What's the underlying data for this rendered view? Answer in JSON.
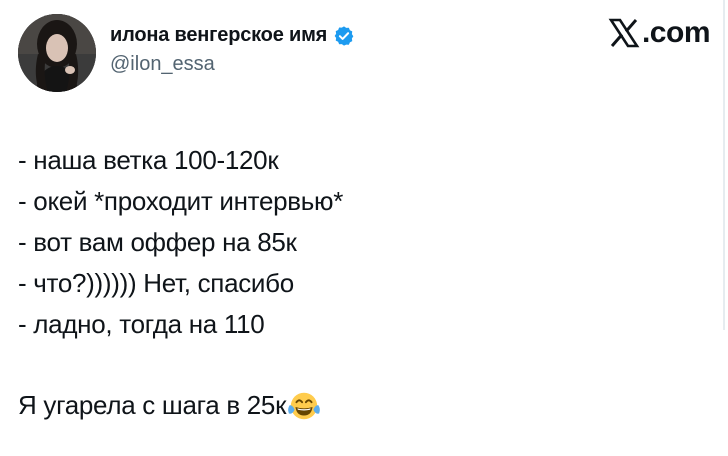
{
  "header": {
    "display_name": "илона венгерское имя",
    "handle": "@ilon_essa",
    "brand_text": ".com",
    "icons": {
      "verified": "verified-badge-icon",
      "brand_logo": "x-logo-icon"
    },
    "colors": {
      "verified": "#1d9bf0",
      "handle": "#536471",
      "text": "#0f1419"
    }
  },
  "tweet": {
    "lines": [
      "- наша ветка 100-120к",
      "- окей *проходит интервью*",
      "- вот вам оффер на 85к",
      "- что?)))))) Нет, спасибо",
      "- ладно, тогда на 110"
    ],
    "final_line": "Я угарела с шага в 25к",
    "final_emoji": "face-with-tears-of-joy"
  }
}
